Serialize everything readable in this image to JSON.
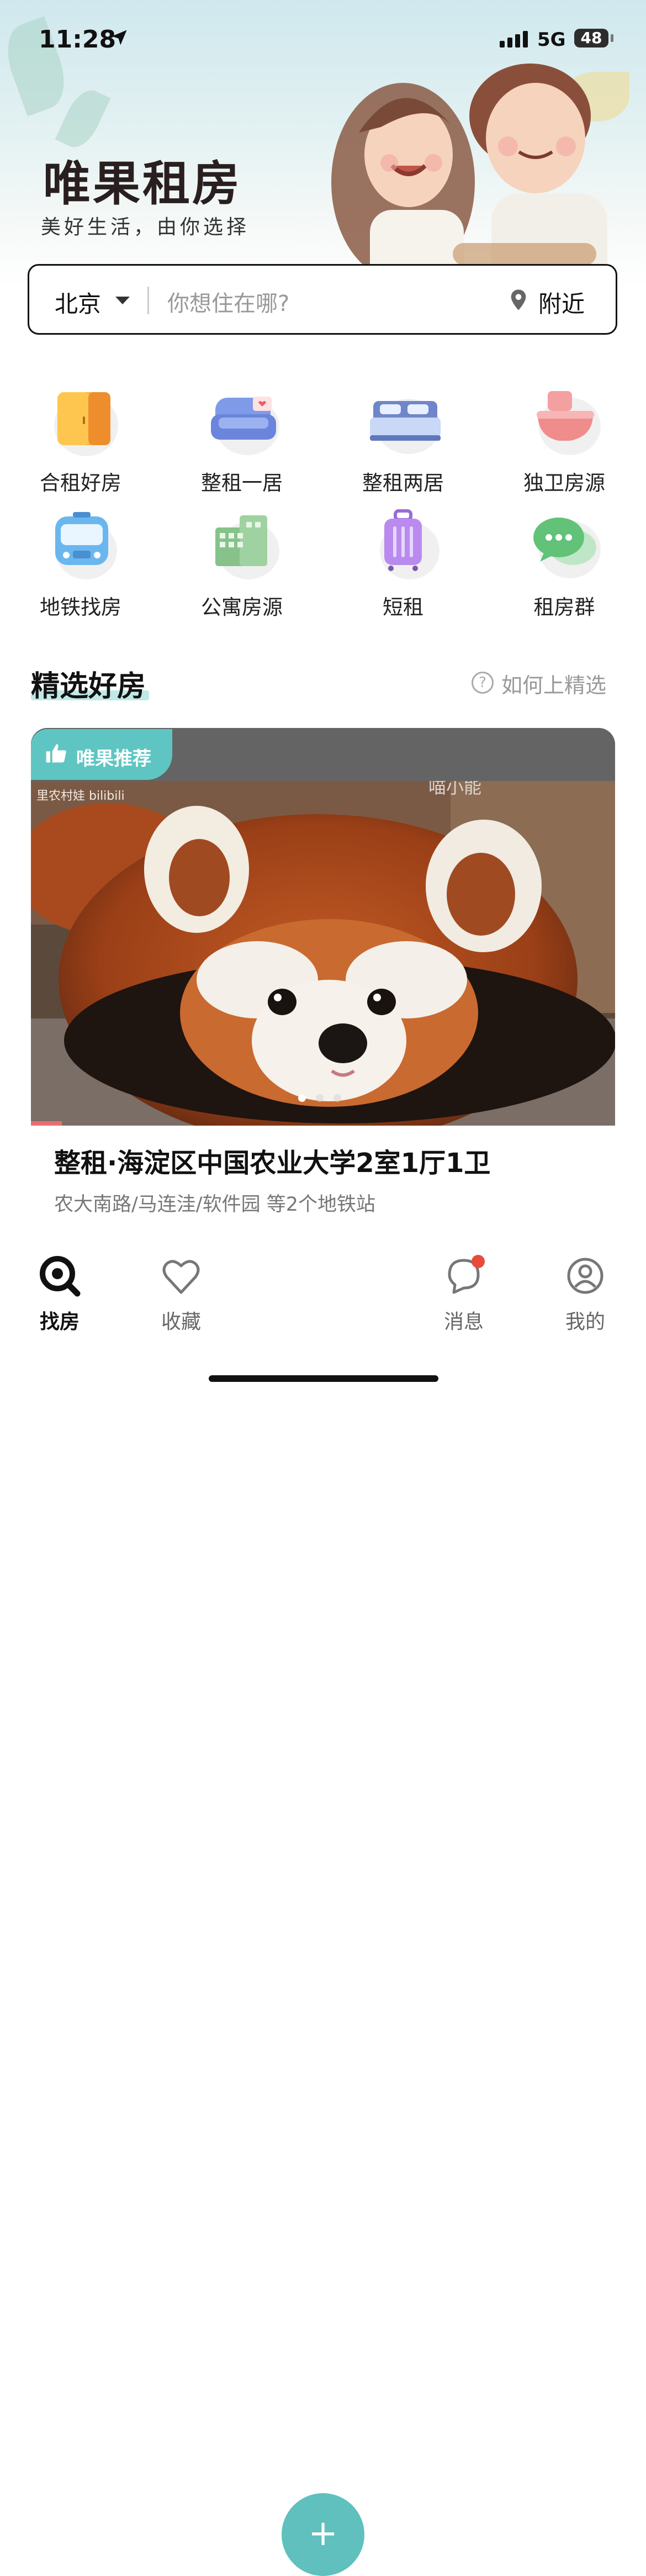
{
  "status_bar": {
    "time": "11:28",
    "network": "5G",
    "battery": "48"
  },
  "header": {
    "brand": "唯果租房",
    "slogan": "美好生活，由你选择"
  },
  "search": {
    "city": "北京",
    "placeholder": "你想住在哪?",
    "nearby": "附近"
  },
  "categories": [
    {
      "label": "合租好房",
      "icon": "door-icon"
    },
    {
      "label": "整租一居",
      "icon": "sofa-icon"
    },
    {
      "label": "整租两居",
      "icon": "bed-icon"
    },
    {
      "label": "独卫房源",
      "icon": "toilet-icon"
    },
    {
      "label": "地铁找房",
      "icon": "metro-icon"
    },
    {
      "label": "公寓房源",
      "icon": "apartment-icon"
    },
    {
      "label": "短租",
      "icon": "suitcase-icon"
    },
    {
      "label": "租房群",
      "icon": "chat-group-icon"
    }
  ],
  "featured": {
    "title": "精选好房",
    "help_link": "如何上精选",
    "card": {
      "badge": "唯果推荐",
      "watermark_left": "里农村娃 bilibili",
      "watermark_right": "喵小能",
      "listing_title": "整租·海淀区中国农业大学2室1厅1卫",
      "listing_subtitle": "农大南路/马连洼/软件园 等2个地铁站",
      "image_count": 3,
      "active_image": 1
    }
  },
  "tabbar": {
    "items": [
      {
        "label": "找房",
        "icon": "search-icon",
        "active": true
      },
      {
        "label": "收藏",
        "icon": "heart-icon",
        "active": false
      },
      {
        "label": "+",
        "icon": "plus-icon",
        "active": false
      },
      {
        "label": "消息",
        "icon": "message-icon",
        "active": false,
        "badge": true
      },
      {
        "label": "我的",
        "icon": "profile-icon",
        "active": false
      }
    ]
  },
  "colors": {
    "accent": "#5fc0bd",
    "badge_red": "#e84b3c",
    "underline": "#bfe9e6"
  }
}
